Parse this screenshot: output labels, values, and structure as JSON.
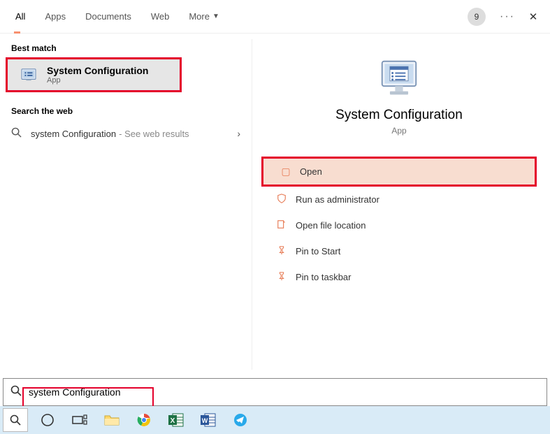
{
  "header": {
    "tabs": [
      "All",
      "Apps",
      "Documents",
      "Web",
      "More"
    ],
    "badge": "9"
  },
  "left": {
    "best_match_label": "Best match",
    "result": {
      "title": "System Configuration",
      "subtitle": "App"
    },
    "search_web_label": "Search the web",
    "web_item": {
      "text": "system Configuration",
      "suffix": "- See web results"
    }
  },
  "detail": {
    "title": "System Configuration",
    "subtitle": "App",
    "actions": {
      "open": "Open",
      "run_admin": "Run as administrator",
      "open_loc": "Open file location",
      "pin_start": "Pin to Start",
      "pin_taskbar": "Pin to taskbar"
    }
  },
  "search": {
    "value": "system Configuration"
  }
}
